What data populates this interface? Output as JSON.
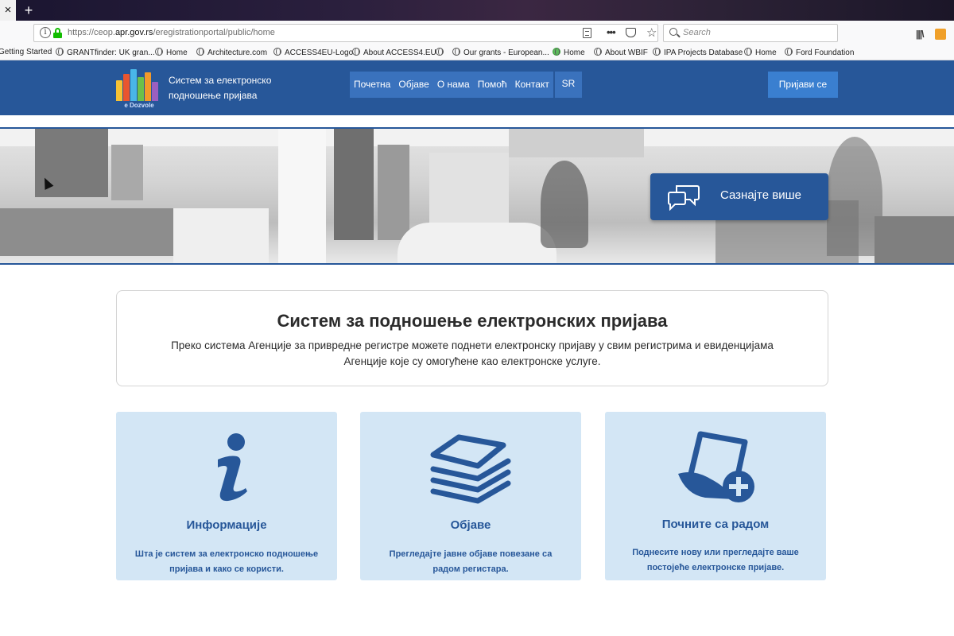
{
  "browser": {
    "tab_close": "×",
    "tab_new": "+",
    "url_prefix": "https://ceop.",
    "url_host": "apr.gov.rs",
    "url_path": "/eregistrationportal/public/home",
    "more_label": "•••",
    "star_label": "☆",
    "search_placeholder": "Search",
    "library_label": "|||\\",
    "bookmarks": [
      "Getting Started",
      "GRANTfinder: UK gran...",
      "Home",
      "Architecture.com",
      "ACCESS4EU-Logo",
      "About ACCESS4.EU",
      "",
      "Our grants - European...",
      "Home",
      "About WBIF",
      "IPA Projects Database",
      "Home",
      "Ford Foundation"
    ]
  },
  "site": {
    "logo_text": "e Dozvole",
    "brand_line1": "Систем за електронско",
    "brand_line2": "подношење пријава",
    "nav": [
      "Почетна",
      "Објаве",
      "О нама",
      "Помоћ",
      "Контакт"
    ],
    "lang": "SR",
    "login": "Пријави се"
  },
  "hero": {
    "cta": "Сазнајте више"
  },
  "intro": {
    "title": "Систем за подношење електронских пријава",
    "text": "Преко система Агенције за привредне регистре можете поднети електронску пријаву у свим регистрима и евиденцијама Агенције које су омогућене као електронске услуге."
  },
  "cards": [
    {
      "title": "Информације",
      "desc": "Шта је систем за електронско подношење пријава и како се користи."
    },
    {
      "title": "Објаве",
      "desc": "Прегледајте јавне објаве повезане са радом регистара."
    },
    {
      "title": "Почните са радом",
      "desc": "Поднесите нову или прегледајте ваше постојеће електронске пријаве."
    }
  ],
  "colors": {
    "header": "#275799",
    "card_bg": "#d3e6f5",
    "accent": "#3a72bd"
  }
}
